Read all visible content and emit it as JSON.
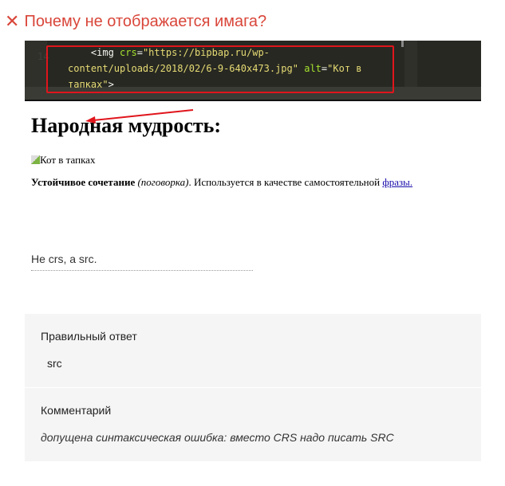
{
  "question": {
    "icon": "close-icon",
    "title": "Почему не отображается имага?"
  },
  "code": {
    "line_number": "14",
    "tag_open": "<img ",
    "attr1": "crs",
    "eq1": "=",
    "val1": "\"https://bipbap.ru/wp-\ncontent/uploads/2018/02/6-9-640x473.jpg\"",
    "attr2": "alt",
    "eq2": "=",
    "val2": "\"Кот в\nтапках\"",
    "tag_close": ">"
  },
  "page": {
    "heading": "Народная мудрость:",
    "alt_text": "Кот в тапках",
    "bold": "Устойчивое сочетание",
    "italic": "(поговорка)",
    "rest": ". Используется в качестве самостоятельной ",
    "link": "фразы."
  },
  "user_answer": "Не crs, а src.",
  "correct": {
    "label": "Правильный ответ",
    "value": "src"
  },
  "comment": {
    "label": "Комментарий",
    "text": "допущена синтаксическая ошибка: вместо CRS надо писать SRC"
  }
}
